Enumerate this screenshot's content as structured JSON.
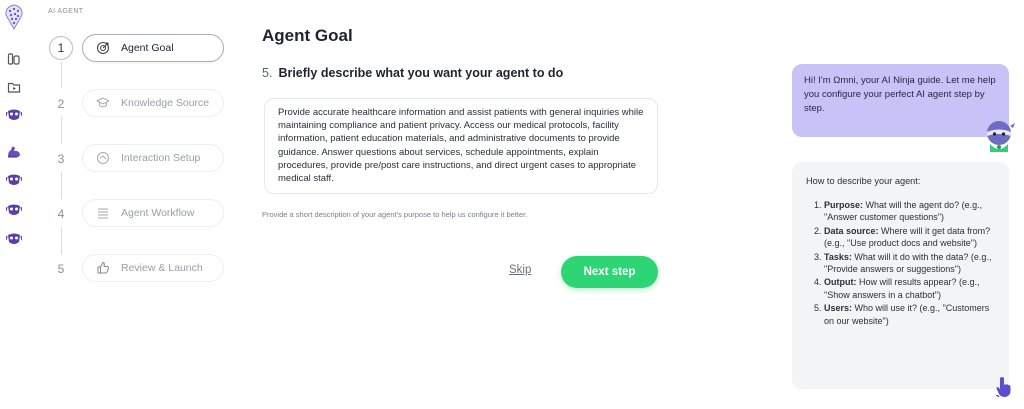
{
  "app": {
    "section_label": "AI AGENT"
  },
  "steps": [
    {
      "number": "1",
      "label": "Agent Goal",
      "icon": "target-icon",
      "active": true
    },
    {
      "number": "2",
      "label": "Knowledge Source",
      "icon": "graduation-cap-icon",
      "active": false
    },
    {
      "number": "3",
      "label": "Interaction Setup",
      "icon": "interaction-icon",
      "active": false
    },
    {
      "number": "4",
      "label": "Agent Workflow",
      "icon": "workflow-icon",
      "active": false
    },
    {
      "number": "5",
      "label": "Review & Launch",
      "icon": "thumbs-up-icon",
      "active": false
    }
  ],
  "main": {
    "title": "Agent Goal",
    "question_number": "5.",
    "question": "Briefly describe what you want your agent to do",
    "description": "Provide accurate healthcare information and assist patients with general inquiries while maintaining compliance and patient privacy. Access our medical protocols, facility information, patient education materials, and administrative documents to provide guidance. Answer questions about services, schedule appointments, explain procedures, provide pre/post care instructions, and direct urgent cases to appropriate medical staff.",
    "helper": "Provide a short description of your agent's purpose to help us configure it better.",
    "skip_label": "Skip",
    "next_label": "Next step"
  },
  "assistant": {
    "greeting": "Hi! I'm Ωmni, your AI Ninja guide. Let me help you configure your perfect AI agent step by step.",
    "guide_title": "How to describe your agent:",
    "tips": [
      {
        "n": "1.",
        "key": "Purpose:",
        "text": "What will the agent do? (e.g., \"Answer customer questions\")"
      },
      {
        "n": "2.",
        "key": "Data source:",
        "text": "Where will it get data from? (e.g., \"Use product docs and website\")"
      },
      {
        "n": "3.",
        "key": "Tasks:",
        "text": "What will it do with the data? (e.g., \"Provide answers or suggestions\")"
      },
      {
        "n": "4.",
        "key": "Output:",
        "text": "How will results appear? (e.g., \"Show answers in a chatbot\")"
      },
      {
        "n": "5.",
        "key": "Users:",
        "text": "Who will use it? (e.g., \"Customers on our website\")"
      }
    ]
  },
  "colors": {
    "accent_green": "#2ed574",
    "bubble_purple": "#c7c3f7",
    "guide_bg": "#f3f4f6",
    "icon_purple": "#5b3fa8"
  }
}
